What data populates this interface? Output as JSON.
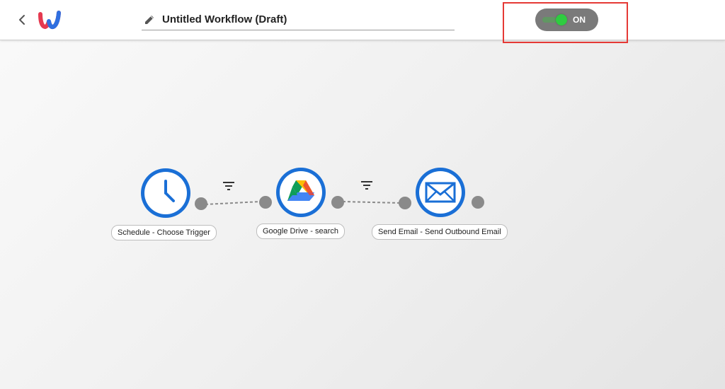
{
  "header": {
    "title": "Untitled Workflow (Draft)",
    "toggle": {
      "state_label": "ON",
      "is_on": true
    },
    "accent": "#1a6fd6",
    "toggle_on_color": "#2ecc40",
    "highlight_color": "#e53935"
  },
  "workflow": {
    "nodes": [
      {
        "label": "Schedule - Choose Trigger",
        "icon": "clock-icon"
      },
      {
        "label": "Google Drive - search",
        "icon": "google-drive-icon"
      },
      {
        "label": "Send Email - Send Outbound Email",
        "icon": "envelope-icon"
      }
    ],
    "connectors": [
      {
        "filter_icon": "filter-icon"
      },
      {
        "filter_icon": "filter-icon"
      }
    ]
  }
}
